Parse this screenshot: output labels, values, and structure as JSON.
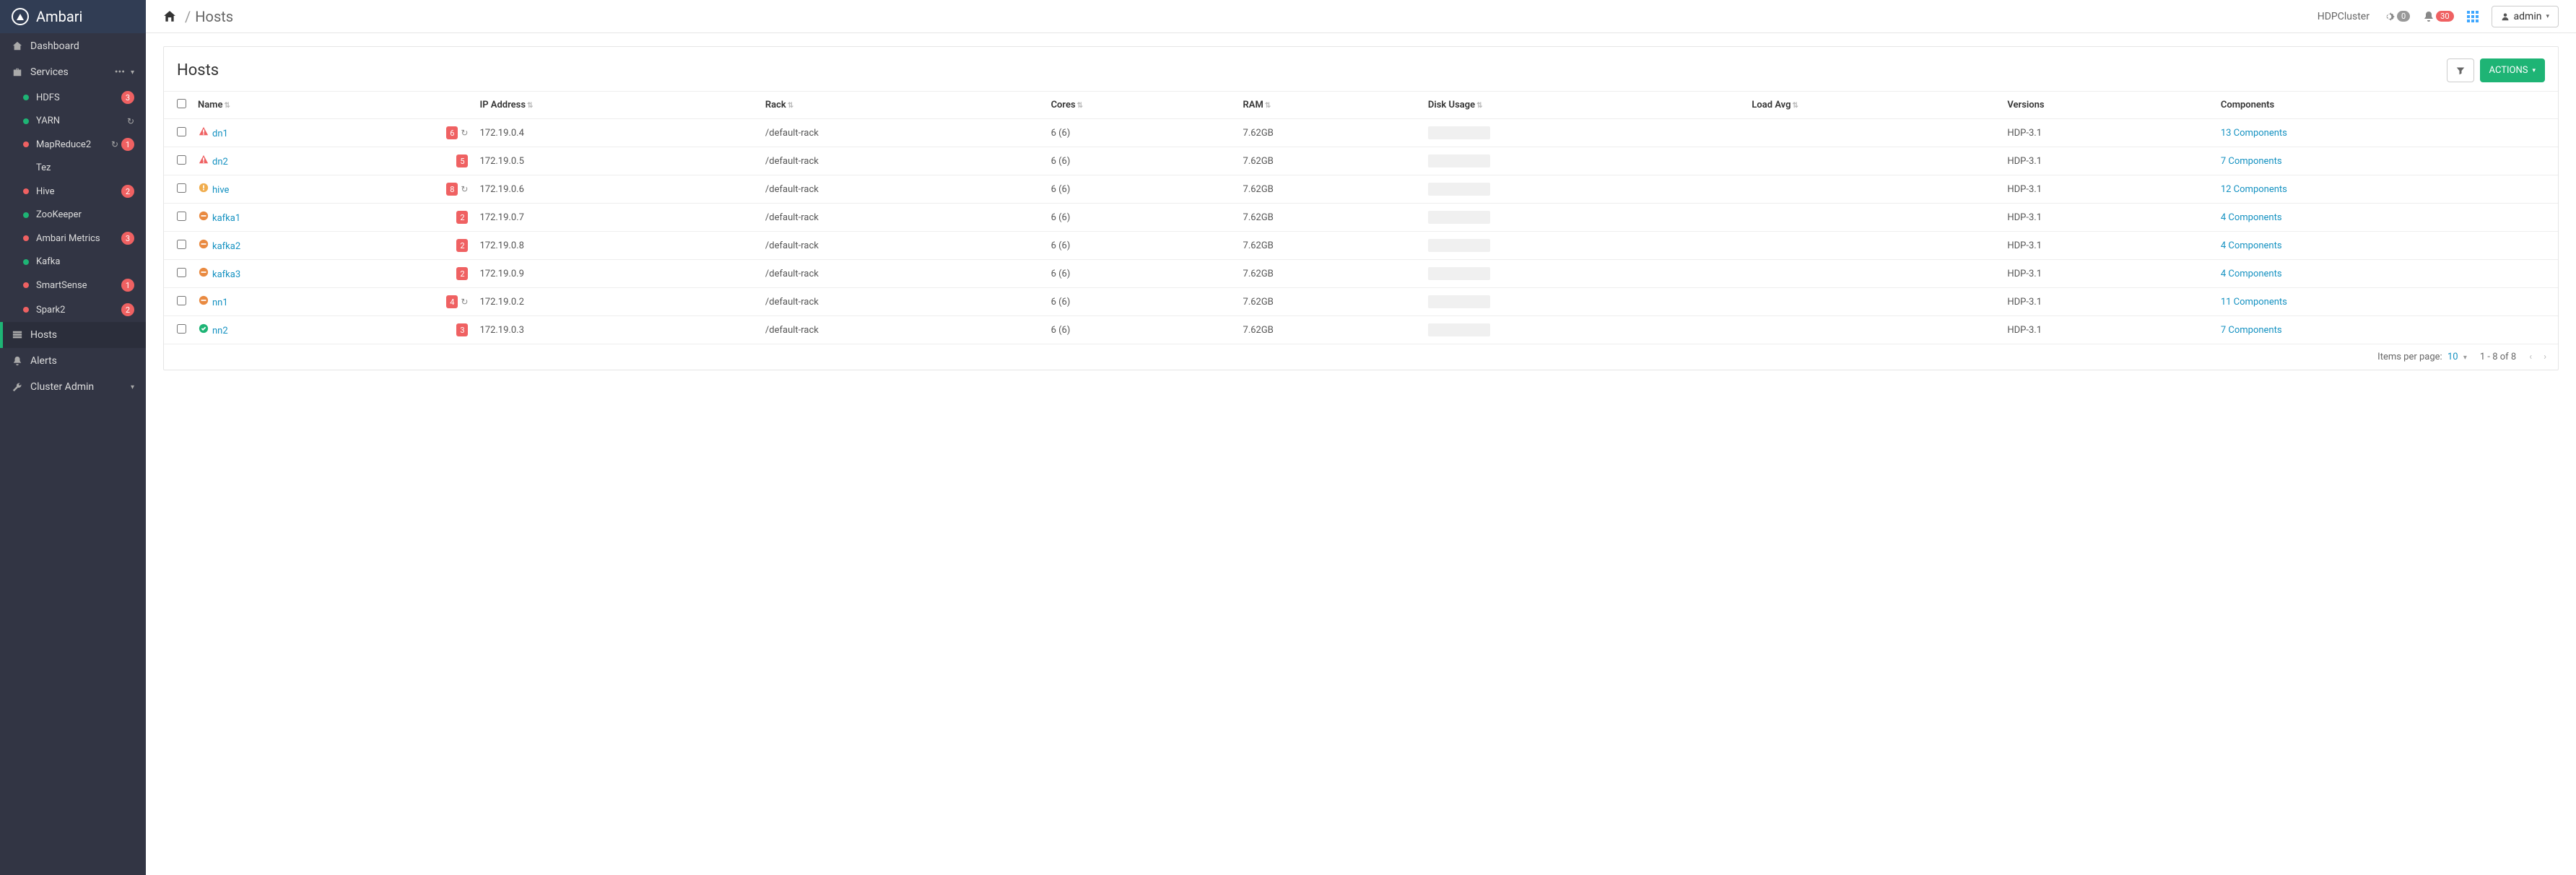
{
  "brand": "Ambari",
  "cluster": "HDPCluster",
  "gear_count": "0",
  "alert_count": "30",
  "admin_label": "admin",
  "breadcrumb": {
    "current": "Hosts"
  },
  "nav": {
    "dashboard": "Dashboard",
    "services": "Services",
    "hosts": "Hosts",
    "alerts": "Alerts",
    "cluster_admin": "Cluster Admin"
  },
  "services": [
    {
      "name": "HDFS",
      "status": "green",
      "badge": "3",
      "refresh": false
    },
    {
      "name": "YARN",
      "status": "green",
      "badge": "",
      "refresh": true
    },
    {
      "name": "MapReduce2",
      "status": "red",
      "badge": "1",
      "refresh": true
    },
    {
      "name": "Tez",
      "status": "",
      "badge": "",
      "refresh": false
    },
    {
      "name": "Hive",
      "status": "red",
      "badge": "2",
      "refresh": false
    },
    {
      "name": "ZooKeeper",
      "status": "green",
      "badge": "",
      "refresh": false
    },
    {
      "name": "Ambari Metrics",
      "status": "red",
      "badge": "3",
      "refresh": false
    },
    {
      "name": "Kafka",
      "status": "green",
      "badge": "",
      "refresh": false
    },
    {
      "name": "SmartSense",
      "status": "red",
      "badge": "1",
      "refresh": false
    },
    {
      "name": "Spark2",
      "status": "red",
      "badge": "2",
      "refresh": false
    }
  ],
  "page": {
    "title": "Hosts",
    "actions_label": "ACTIONS"
  },
  "columns": {
    "name": "Name",
    "ip": "IP Address",
    "rack": "Rack",
    "cores": "Cores",
    "ram": "RAM",
    "disk": "Disk Usage",
    "load": "Load Avg",
    "versions": "Versions",
    "components": "Components"
  },
  "hosts": [
    {
      "name": "dn1",
      "status": "crit",
      "alerts": "6",
      "refresh": true,
      "ip": "172.19.0.4",
      "rack": "/default-rack",
      "cores": "6 (6)",
      "ram": "7.62GB",
      "version": "HDP-3.1",
      "components": "13 Components"
    },
    {
      "name": "dn2",
      "status": "crit",
      "alerts": "5",
      "refresh": false,
      "ip": "172.19.0.5",
      "rack": "/default-rack",
      "cores": "6 (6)",
      "ram": "7.62GB",
      "version": "HDP-3.1",
      "components": "7 Components"
    },
    {
      "name": "hive",
      "status": "warn",
      "alerts": "8",
      "refresh": true,
      "ip": "172.19.0.6",
      "rack": "/default-rack",
      "cores": "6 (6)",
      "ram": "7.62GB",
      "version": "HDP-3.1",
      "components": "12 Components"
    },
    {
      "name": "kafka1",
      "status": "maint",
      "alerts": "2",
      "refresh": false,
      "ip": "172.19.0.7",
      "rack": "/default-rack",
      "cores": "6 (6)",
      "ram": "7.62GB",
      "version": "HDP-3.1",
      "components": "4 Components"
    },
    {
      "name": "kafka2",
      "status": "maint",
      "alerts": "2",
      "refresh": false,
      "ip": "172.19.0.8",
      "rack": "/default-rack",
      "cores": "6 (6)",
      "ram": "7.62GB",
      "version": "HDP-3.1",
      "components": "4 Components"
    },
    {
      "name": "kafka3",
      "status": "maint",
      "alerts": "2",
      "refresh": false,
      "ip": "172.19.0.9",
      "rack": "/default-rack",
      "cores": "6 (6)",
      "ram": "7.62GB",
      "version": "HDP-3.1",
      "components": "4 Components"
    },
    {
      "name": "nn1",
      "status": "maint",
      "alerts": "4",
      "refresh": true,
      "ip": "172.19.0.2",
      "rack": "/default-rack",
      "cores": "6 (6)",
      "ram": "7.62GB",
      "version": "HDP-3.1",
      "components": "11 Components"
    },
    {
      "name": "nn2",
      "status": "ok",
      "alerts": "3",
      "refresh": false,
      "ip": "172.19.0.3",
      "rack": "/default-rack",
      "cores": "6 (6)",
      "ram": "7.62GB",
      "version": "HDP-3.1",
      "components": "7 Components"
    }
  ],
  "pagination": {
    "items_per_page_label": "Items per page:",
    "per_page": "10",
    "range": "1 - 8 of 8"
  }
}
